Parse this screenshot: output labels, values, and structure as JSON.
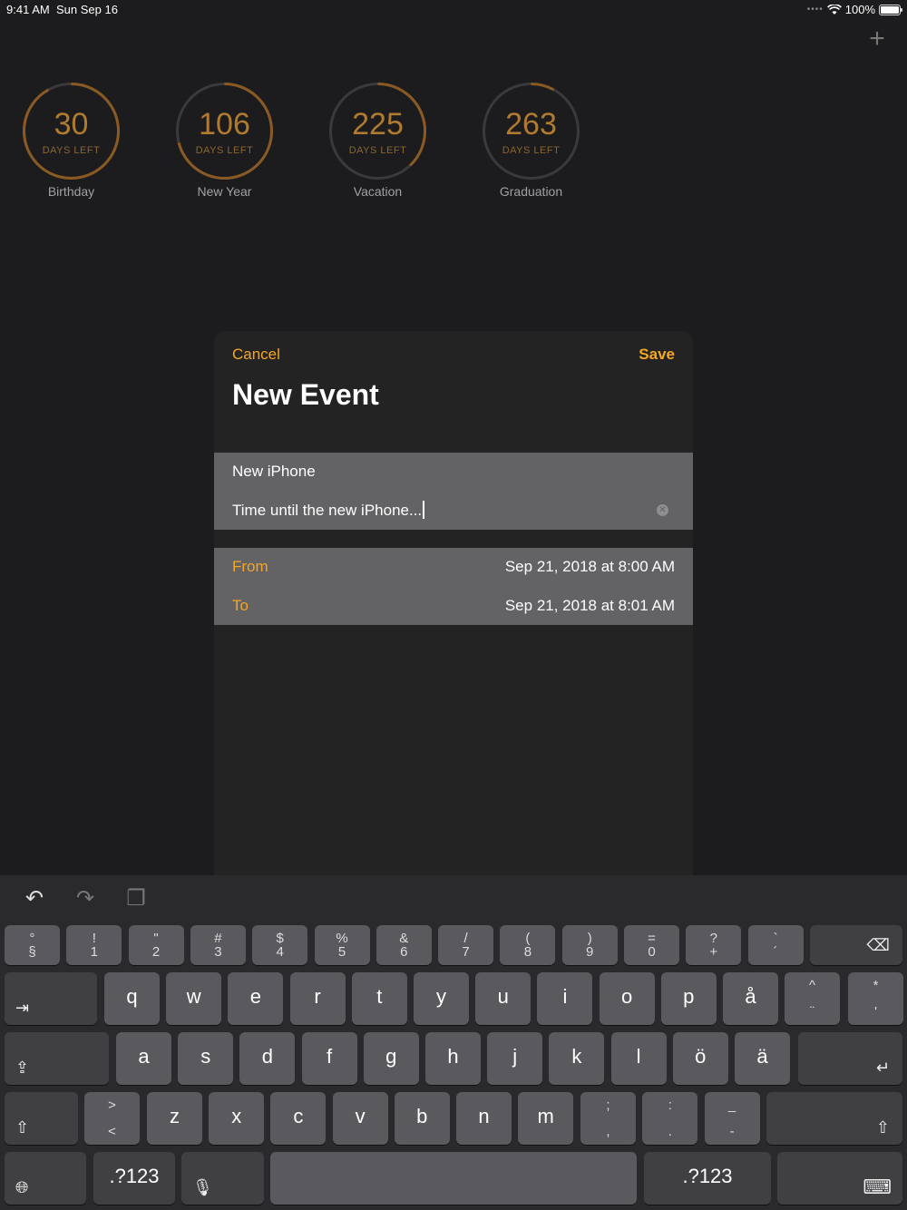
{
  "status_bar": {
    "time": "9:41 AM",
    "date": "Sun Sep 16",
    "battery": "100%"
  },
  "icons": {
    "add": "plus-icon"
  },
  "countdowns": [
    {
      "days": "30",
      "sub": "DAYS LEFT",
      "label": "Birthday",
      "progress": 0.92
    },
    {
      "days": "106",
      "sub": "DAYS LEFT",
      "label": "New Year",
      "progress": 0.71
    },
    {
      "days": "225",
      "sub": "DAYS LEFT",
      "label": "Vacation",
      "progress": 0.38
    },
    {
      "days": "263",
      "sub": "DAYS LEFT",
      "label": "Graduation",
      "progress": 0.08
    }
  ],
  "ring_colors": {
    "track": "#3a3a3c",
    "progress": "#8a5a22"
  },
  "modal": {
    "cancel": "Cancel",
    "save": "Save",
    "title": "New Event",
    "name": "New iPhone",
    "description": "Time until the new iPhone...",
    "from_label": "From",
    "from_value": "Sep 21, 2018 at 8:00 AM",
    "to_label": "To",
    "to_value": "Sep 21, 2018 at 8:01 AM"
  },
  "keyboard": {
    "row1": [
      {
        "t": "°",
        "b": "§"
      },
      {
        "t": "!",
        "b": "1"
      },
      {
        "t": "\"",
        "b": "2"
      },
      {
        "t": "#",
        "b": "3"
      },
      {
        "t": "$",
        "b": "4"
      },
      {
        "t": "%",
        "b": "5"
      },
      {
        "t": "&",
        "b": "6"
      },
      {
        "t": "/",
        "b": "7"
      },
      {
        "t": "(",
        "b": "8"
      },
      {
        "t": ")",
        "b": "9"
      },
      {
        "t": "=",
        "b": "0"
      },
      {
        "t": "?",
        "b": "+"
      },
      {
        "t": "`",
        "b": "´"
      }
    ],
    "row2": [
      "q",
      "w",
      "e",
      "r",
      "t",
      "y",
      "u",
      "i",
      "o",
      "p",
      "å"
    ],
    "row2_dual": [
      {
        "t": "^",
        "b": "¨"
      },
      {
        "t": "*",
        "b": "'"
      }
    ],
    "row3": [
      "a",
      "s",
      "d",
      "f",
      "g",
      "h",
      "j",
      "k",
      "l",
      "ö",
      "ä"
    ],
    "row4_first": {
      "t": ">",
      "b": "<"
    },
    "row4": [
      "z",
      "x",
      "c",
      "v",
      "b",
      "n",
      "m"
    ],
    "row4_dual": [
      {
        "t": ";",
        "b": ","
      },
      {
        "t": ":",
        "b": "."
      },
      {
        "t": "_",
        "b": "-"
      }
    ],
    "num_label": ".?123"
  }
}
